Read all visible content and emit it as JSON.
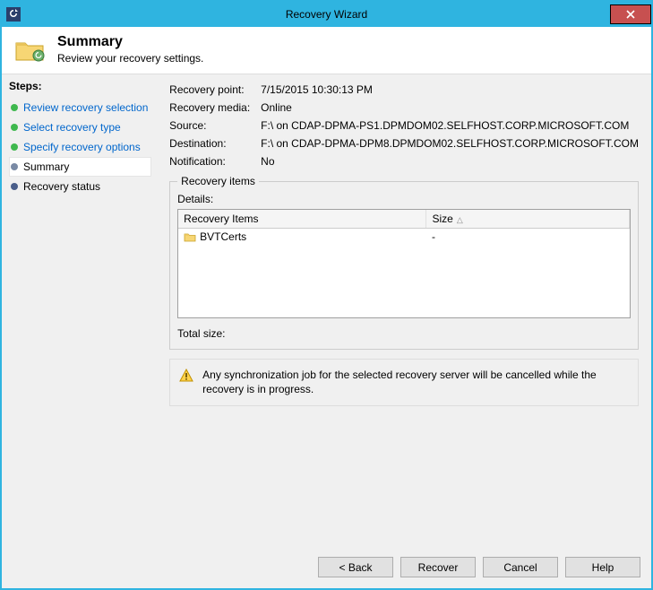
{
  "window": {
    "title": "Recovery Wizard"
  },
  "header": {
    "title": "Summary",
    "subtitle": "Review your recovery settings."
  },
  "sidebar": {
    "heading": "Steps:",
    "steps": [
      {
        "label": "Review recovery selection",
        "state": "done"
      },
      {
        "label": "Select recovery type",
        "state": "done"
      },
      {
        "label": "Specify recovery options",
        "state": "done"
      },
      {
        "label": "Summary",
        "state": "current"
      },
      {
        "label": "Recovery status",
        "state": "pending"
      }
    ]
  },
  "summary": {
    "recovery_point_label": "Recovery point:",
    "recovery_point": "7/15/2015 10:30:13 PM",
    "recovery_media_label": "Recovery media:",
    "recovery_media": "Online",
    "source_label": "Source:",
    "source": "F:\\ on CDAP-DPMA-PS1.DPMDOM02.SELFHOST.CORP.MICROSOFT.COM",
    "destination_label": "Destination:",
    "destination": "F:\\ on CDAP-DPMA-DPM8.DPMDOM02.SELFHOST.CORP.MICROSOFT.COM",
    "notification_label": "Notification:",
    "notification": "No"
  },
  "recovery_items": {
    "legend": "Recovery items",
    "details_label": "Details:",
    "columns": {
      "name": "Recovery Items",
      "size": "Size"
    },
    "rows": [
      {
        "name": "BVTCerts",
        "size": "-"
      }
    ],
    "total_size_label": "Total size:",
    "total_size_value": ""
  },
  "warning": {
    "text": "Any synchronization job for the selected recovery server will be cancelled while the recovery is in progress."
  },
  "buttons": {
    "back": "< Back",
    "recover": "Recover",
    "cancel": "Cancel",
    "help": "Help"
  }
}
